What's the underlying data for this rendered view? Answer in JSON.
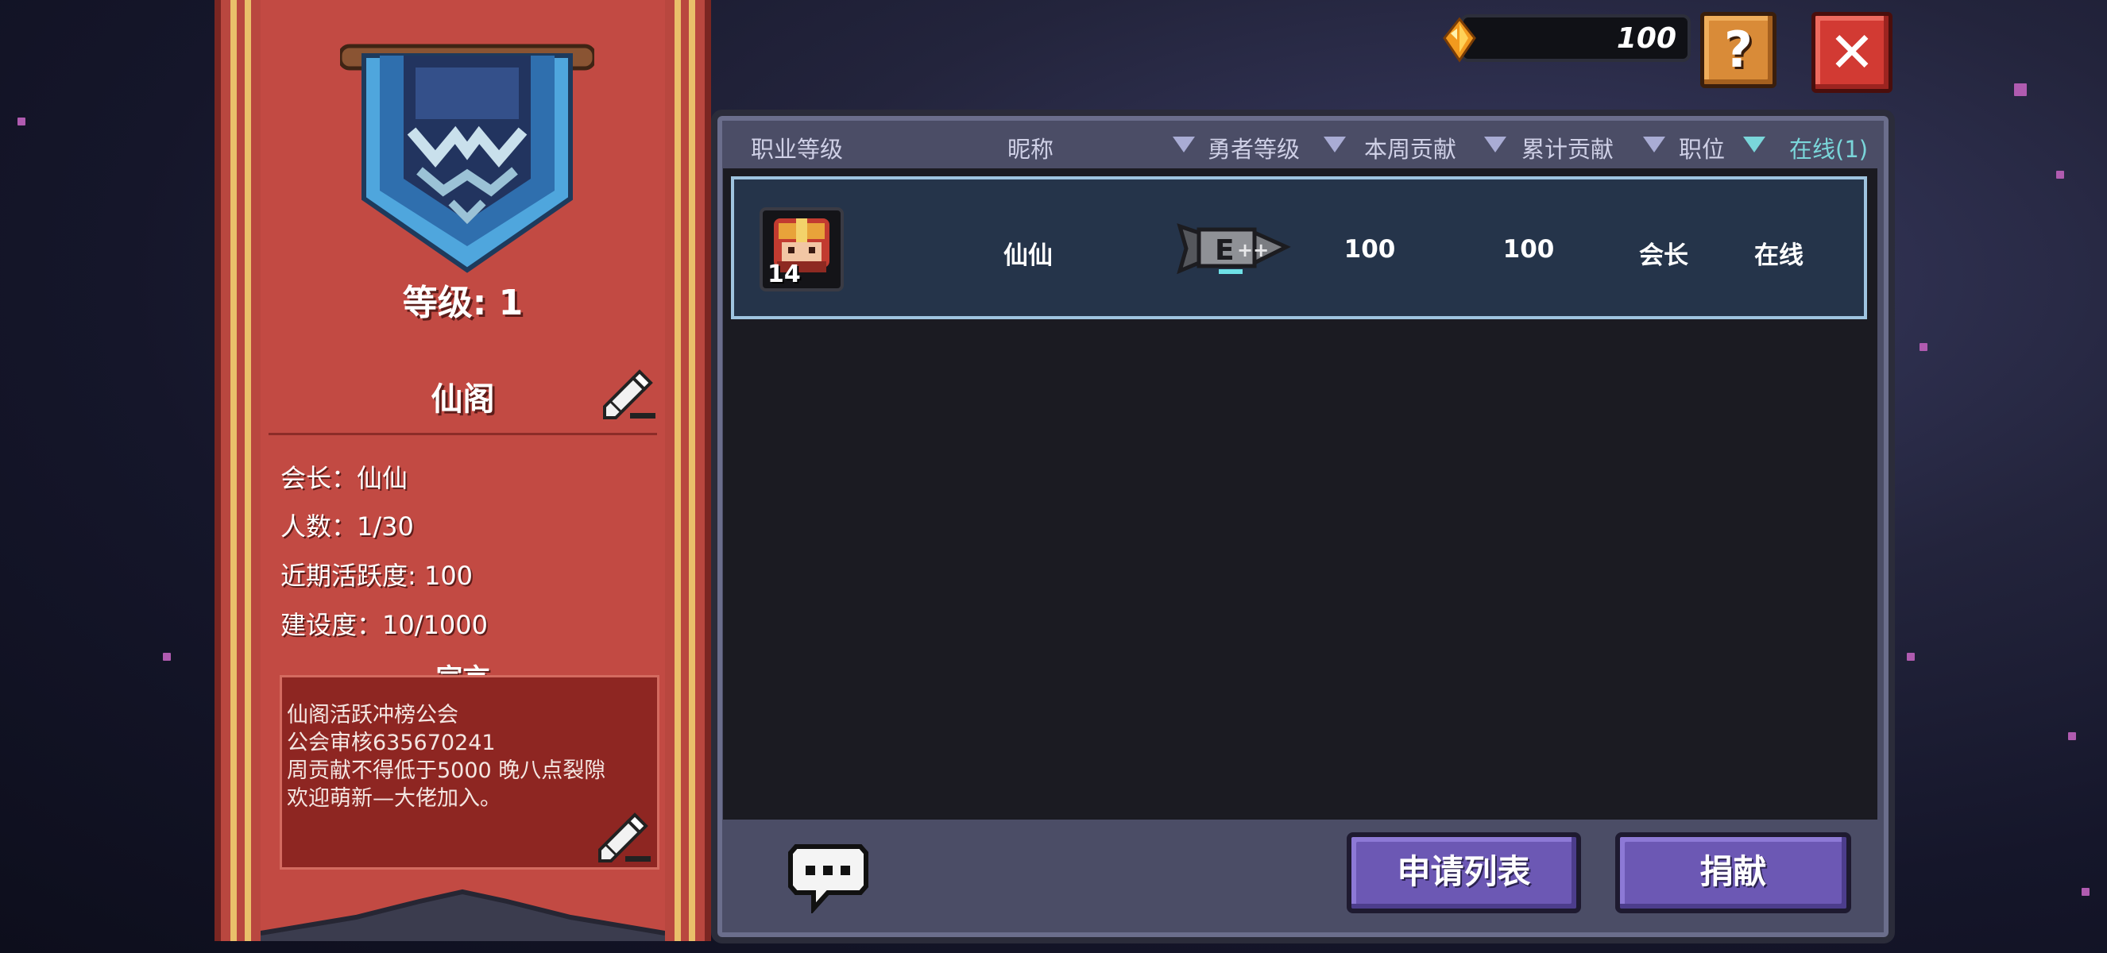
{
  "top_bar": {
    "currency_value": "100",
    "currency_icon": "orange-gem-icon",
    "help_label": "?",
    "close_label": "✕"
  },
  "guild": {
    "level_text": "等级: 1",
    "name": "仙阁",
    "info": {
      "leader": "会长：仙仙",
      "members": "人数：1/30",
      "activity": "近期活跃度: 100",
      "construction": "建设度：10/1000"
    },
    "declaration_title": "宣言",
    "declaration_lines": [
      "仙阁活跃冲榜公会",
      "公会审核635670241",
      "周贡献不得低于5000 晚八点裂隙",
      "欢迎萌新—大佬加入。"
    ]
  },
  "table": {
    "headers": {
      "class_level": "职业等级",
      "nickname": "昵称",
      "hero_level": "勇者等级",
      "weekly_contribution": "本周贡献",
      "total_contribution": "累计贡献",
      "position": "职位",
      "online": "在线(1)"
    },
    "rows": [
      {
        "avatar_level": "14",
        "nickname": "仙仙",
        "hero_rank_icon": "rank-emblem-icon",
        "weekly_contribution": "100",
        "total_contribution": "100",
        "position": "会长",
        "status": "在线"
      }
    ]
  },
  "buttons": {
    "apply_list": "申请列表",
    "donate": "捐献"
  },
  "colors": {
    "banner_red": "#c24a43",
    "panel_bg": "#4b4d66",
    "button_purple": "#6c58b4",
    "online_teal": "#7ad6da"
  }
}
